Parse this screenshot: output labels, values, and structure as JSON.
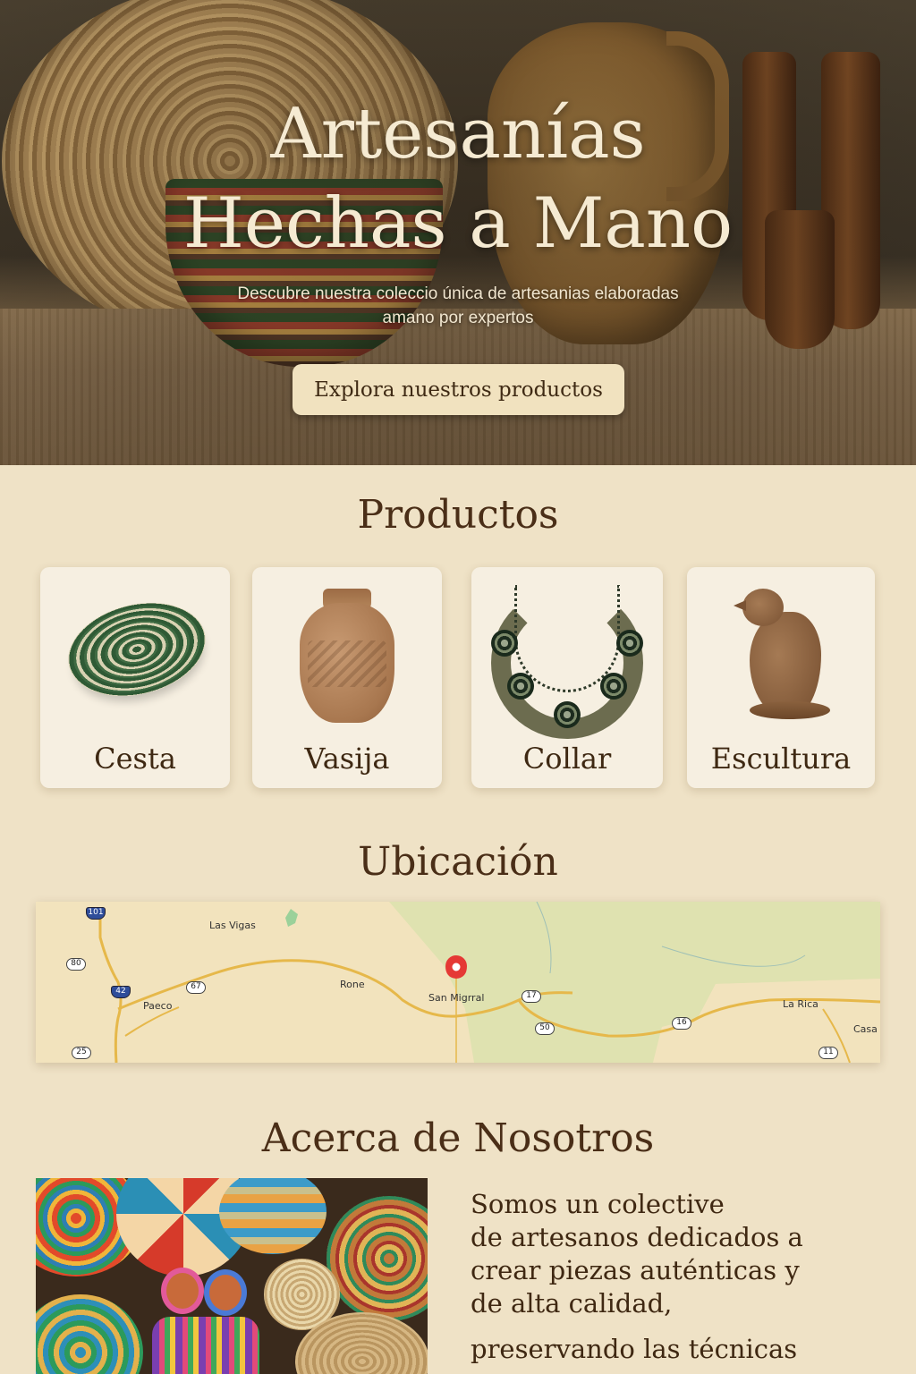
{
  "hero": {
    "title_line1": "Artesanías",
    "title_line2": "Hechas a Mano",
    "subtitle_line1": "Descubre nuestra coleccio única de artesanias elaboradas",
    "subtitle_line2": "amano por expertos",
    "cta_label": "Explora nuestros productos"
  },
  "products": {
    "title": "Productos",
    "items": [
      {
        "label": "Cesta"
      },
      {
        "label": "Vasija"
      },
      {
        "label": "Collar"
      },
      {
        "label": "Escultura"
      }
    ]
  },
  "location": {
    "title": "Ubicación",
    "map": {
      "pin_label": "San Migrral",
      "places": [
        "Las Vigas",
        "Paeco",
        "Rone",
        "San Migrral",
        "La Rica",
        "Casa"
      ],
      "routes": [
        "101",
        "80",
        "42",
        "67",
        "25",
        "17",
        "50",
        "16",
        "11"
      ]
    }
  },
  "about": {
    "title": "Acerca de Nosotros",
    "paragraph1": [
      "Somos un colective",
      "de artesanos dedicados a",
      "crear piezas auténticas y",
      "de alta calidad,"
    ],
    "paragraph2": "preservando las técnicas"
  },
  "colors": {
    "background": "#efe2c6",
    "heading": "#4a2e17",
    "cta_background": "#f1e2bf",
    "card_background": "#f6efe1",
    "map_pin": "#e53935"
  }
}
